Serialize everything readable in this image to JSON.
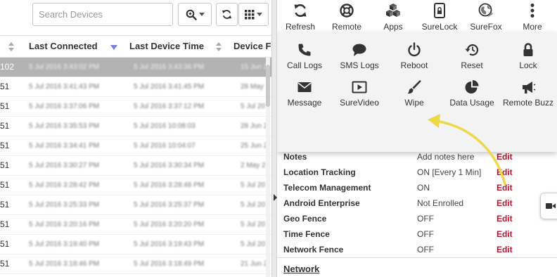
{
  "search": {
    "placeholder": "Search Devices",
    "value": ""
  },
  "columns": [
    {
      "label": "Last Connected",
      "sort": "descending"
    },
    {
      "label": "Last Device Time",
      "sort": "none"
    },
    {
      "label": "Device F",
      "sort": "none"
    }
  ],
  "rows": [
    {
      "id": "102",
      "last_connected": "5 Jul 2016 3:43:02 PM",
      "device_time": "5 Jul 2016 3:43:36 PM",
      "device_f": "15 Jun 2",
      "selected": true
    },
    {
      "id": "51",
      "last_connected": "5 Jul 2016 3:41:43 PM",
      "device_time": "5 Jul 2016 3:41:45 PM",
      "device_f": "28 May",
      "selected": false
    },
    {
      "id": "51",
      "last_connected": "5 Jul 2016 3:37:06 PM",
      "device_time": "5 Jul 2016 3:37:12 PM",
      "device_f": "5 Jul 20",
      "selected": false
    },
    {
      "id": "51",
      "last_connected": "5 Jul 2016 3:35:53 PM",
      "device_time": "5 Jul 2016 10:08:03",
      "device_f": "28 Jun 2",
      "selected": false
    },
    {
      "id": "51",
      "last_connected": "5 Jul 2016 3:34:41 PM",
      "device_time": "5 Jul 2016 10:04:07",
      "device_f": "25 Jun 2",
      "selected": false
    },
    {
      "id": "51",
      "last_connected": "5 Jul 2016 3:30:27 PM",
      "device_time": "5 Jul 2016 3:30:34 PM",
      "device_f": "2 May 2",
      "selected": false
    },
    {
      "id": "51",
      "last_connected": "5 Jul 2016 3:28:42 PM",
      "device_time": "5 Jul 2016 3:28:48 PM",
      "device_f": "5 Jul 20",
      "selected": false
    },
    {
      "id": "51",
      "last_connected": "5 Jul 2016 3:25:33 PM",
      "device_time": "5 Jul 2016 3:25:37 PM",
      "device_f": "5 Jul 20",
      "selected": false
    },
    {
      "id": "51",
      "last_connected": "5 Jul 2016 3:20:16 PM",
      "device_time": "5 Jul 2016 3:20:20 PM",
      "device_f": "5 Jul 20",
      "selected": false
    },
    {
      "id": "51",
      "last_connected": "5 Jul 2016 3:19:40 PM",
      "device_time": "5 Jul 2016 3:19:43 PM",
      "device_f": "5 Jul 20",
      "selected": false
    },
    {
      "id": "51",
      "last_connected": "5 Jul 2016 3:18:46 PM",
      "device_time": "5 Jul 2016 3:18:49 PM",
      "device_f": "21 Jun 2",
      "selected": false
    }
  ],
  "top_actions": [
    {
      "label": "Refresh",
      "icon": "refresh-icon"
    },
    {
      "label": "Remote",
      "icon": "lifebuoy-icon"
    },
    {
      "label": "Apps",
      "icon": "cubes-icon"
    },
    {
      "label": "SureLock",
      "icon": "surelock-icon"
    },
    {
      "label": "SureFox",
      "icon": "globe-icon"
    },
    {
      "label": "More",
      "icon": "vertical-dots-icon"
    }
  ],
  "more_menu": [
    {
      "label": "Call Logs",
      "icon": "phone-icon"
    },
    {
      "label": "SMS Logs",
      "icon": "chat-bubble-icon"
    },
    {
      "label": "Reboot",
      "icon": "power-icon"
    },
    {
      "label": "Reset",
      "icon": "reset-icon"
    },
    {
      "label": "Lock",
      "icon": "padlock-icon"
    },
    {
      "label": "Message",
      "icon": "envelope-icon"
    },
    {
      "label": "SureVideo",
      "icon": "video-play-icon"
    },
    {
      "label": "Wipe",
      "icon": "paintbrush-icon"
    },
    {
      "label": "Data Usage",
      "icon": "pie-chart-icon"
    },
    {
      "label": "Remote Buzz",
      "icon": "megaphone-icon"
    }
  ],
  "details": [
    {
      "label": "Notes",
      "value": "Add notes here",
      "edit": "Edit"
    },
    {
      "label": "Location Tracking",
      "value": "ON [Every 1 Min]",
      "edit": "Edit"
    },
    {
      "label": "Telecom Management",
      "value": "ON",
      "edit": "Edit"
    },
    {
      "label": "Android Enterprise",
      "value": "Not Enrolled",
      "edit": "Edit"
    },
    {
      "label": "Geo Fence",
      "value": "OFF",
      "edit": "Edit"
    },
    {
      "label": "Time Fence",
      "value": "OFF",
      "edit": "Edit"
    },
    {
      "label": "Network Fence",
      "value": "OFF",
      "edit": "Edit"
    }
  ],
  "network_heading": "Network",
  "colors": {
    "accent_red": "#c0112b",
    "annotation_arrow": "#ecd84a",
    "sort_indicator": "#7b7bd8",
    "selected_row": "#b3b3b3"
  }
}
